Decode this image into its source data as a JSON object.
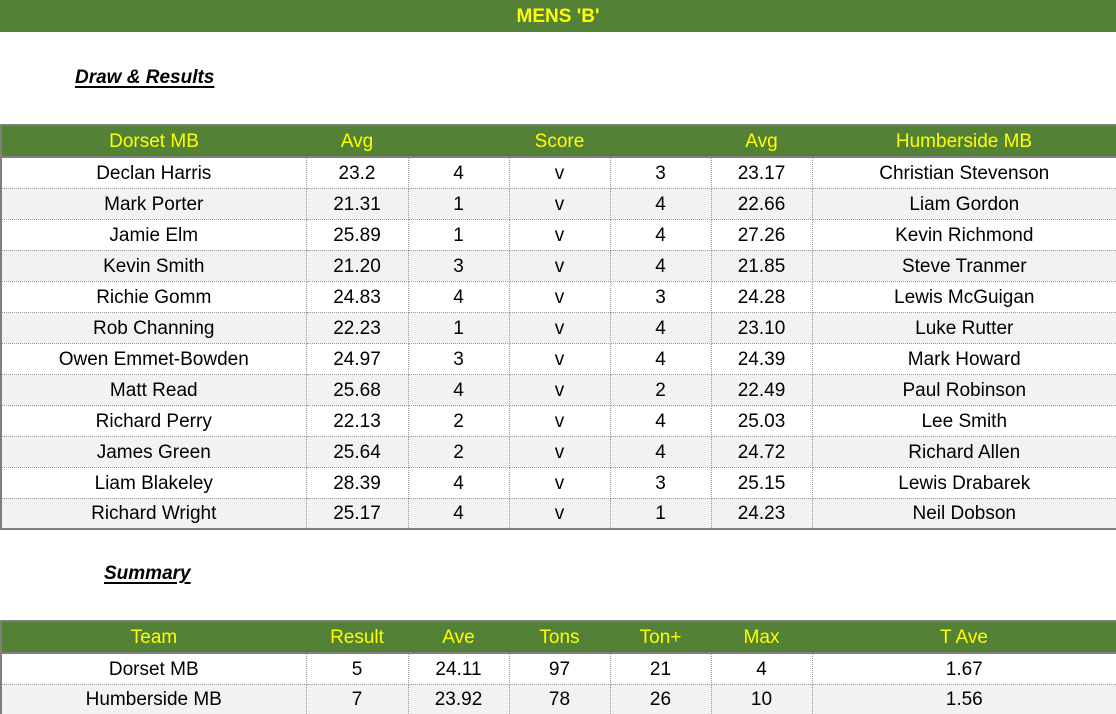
{
  "title": "MENS 'B'",
  "draw_heading": "Draw & Results",
  "results": {
    "headers": {
      "home_team": "Dorset MB",
      "home_avg": "Avg",
      "score": "Score",
      "away_avg": "Avg",
      "away_team": "Humberside MB"
    },
    "rows": [
      {
        "home_player": "Declan Harris",
        "home_avg": "23.2",
        "home_score": "4",
        "vs": "v",
        "away_score": "3",
        "away_avg": "23.17",
        "away_player": "Christian Stevenson"
      },
      {
        "home_player": "Mark Porter",
        "home_avg": "21.31",
        "home_score": "1",
        "vs": "v",
        "away_score": "4",
        "away_avg": "22.66",
        "away_player": "Liam Gordon"
      },
      {
        "home_player": "Jamie Elm",
        "home_avg": "25.89",
        "home_score": "1",
        "vs": "v",
        "away_score": "4",
        "away_avg": "27.26",
        "away_player": "Kevin Richmond"
      },
      {
        "home_player": "Kevin Smith",
        "home_avg": "21.20",
        "home_score": "3",
        "vs": "v",
        "away_score": "4",
        "away_avg": "21.85",
        "away_player": "Steve Tranmer"
      },
      {
        "home_player": "Richie Gomm",
        "home_avg": "24.83",
        "home_score": "4",
        "vs": "v",
        "away_score": "3",
        "away_avg": "24.28",
        "away_player": "Lewis McGuigan"
      },
      {
        "home_player": "Rob Channing",
        "home_avg": "22.23",
        "home_score": "1",
        "vs": "v",
        "away_score": "4",
        "away_avg": "23.10",
        "away_player": "Luke Rutter"
      },
      {
        "home_player": "Owen Emmet-Bowden",
        "home_avg": "24.97",
        "home_score": "3",
        "vs": "v",
        "away_score": "4",
        "away_avg": "24.39",
        "away_player": "Mark Howard"
      },
      {
        "home_player": "Matt Read",
        "home_avg": "25.68",
        "home_score": "4",
        "vs": "v",
        "away_score": "2",
        "away_avg": "22.49",
        "away_player": "Paul Robinson"
      },
      {
        "home_player": "Richard Perry",
        "home_avg": "22.13",
        "home_score": "2",
        "vs": "v",
        "away_score": "4",
        "away_avg": "25.03",
        "away_player": "Lee Smith"
      },
      {
        "home_player": "James Green",
        "home_avg": "25.64",
        "home_score": "2",
        "vs": "v",
        "away_score": "4",
        "away_avg": "24.72",
        "away_player": "Richard Allen"
      },
      {
        "home_player": "Liam Blakeley",
        "home_avg": "28.39",
        "home_score": "4",
        "vs": "v",
        "away_score": "3",
        "away_avg": "25.15",
        "away_player": "Lewis Drabarek"
      },
      {
        "home_player": "Richard Wright",
        "home_avg": "25.17",
        "home_score": "4",
        "vs": "v",
        "away_score": "1",
        "away_avg": "24.23",
        "away_player": "Neil Dobson"
      }
    ]
  },
  "summary_heading": "Summary",
  "summary": {
    "headers": [
      "Team",
      "Result",
      "Ave",
      "Tons",
      "Ton+",
      "Max",
      "T Ave"
    ],
    "rows": [
      {
        "team": "Dorset MB",
        "result": "5",
        "ave": "24.11",
        "tons": "97",
        "ton_plus": "21",
        "max": "4",
        "t_ave": "1.67"
      },
      {
        "team": "Humberside MB",
        "result": "7",
        "ave": "23.92",
        "tons": "78",
        "ton_plus": "26",
        "max": "10",
        "t_ave": "1.56"
      }
    ]
  },
  "colors": {
    "header_bg": "#538135",
    "header_text": "#ffff00",
    "alt_row": "#f2f2f2"
  }
}
